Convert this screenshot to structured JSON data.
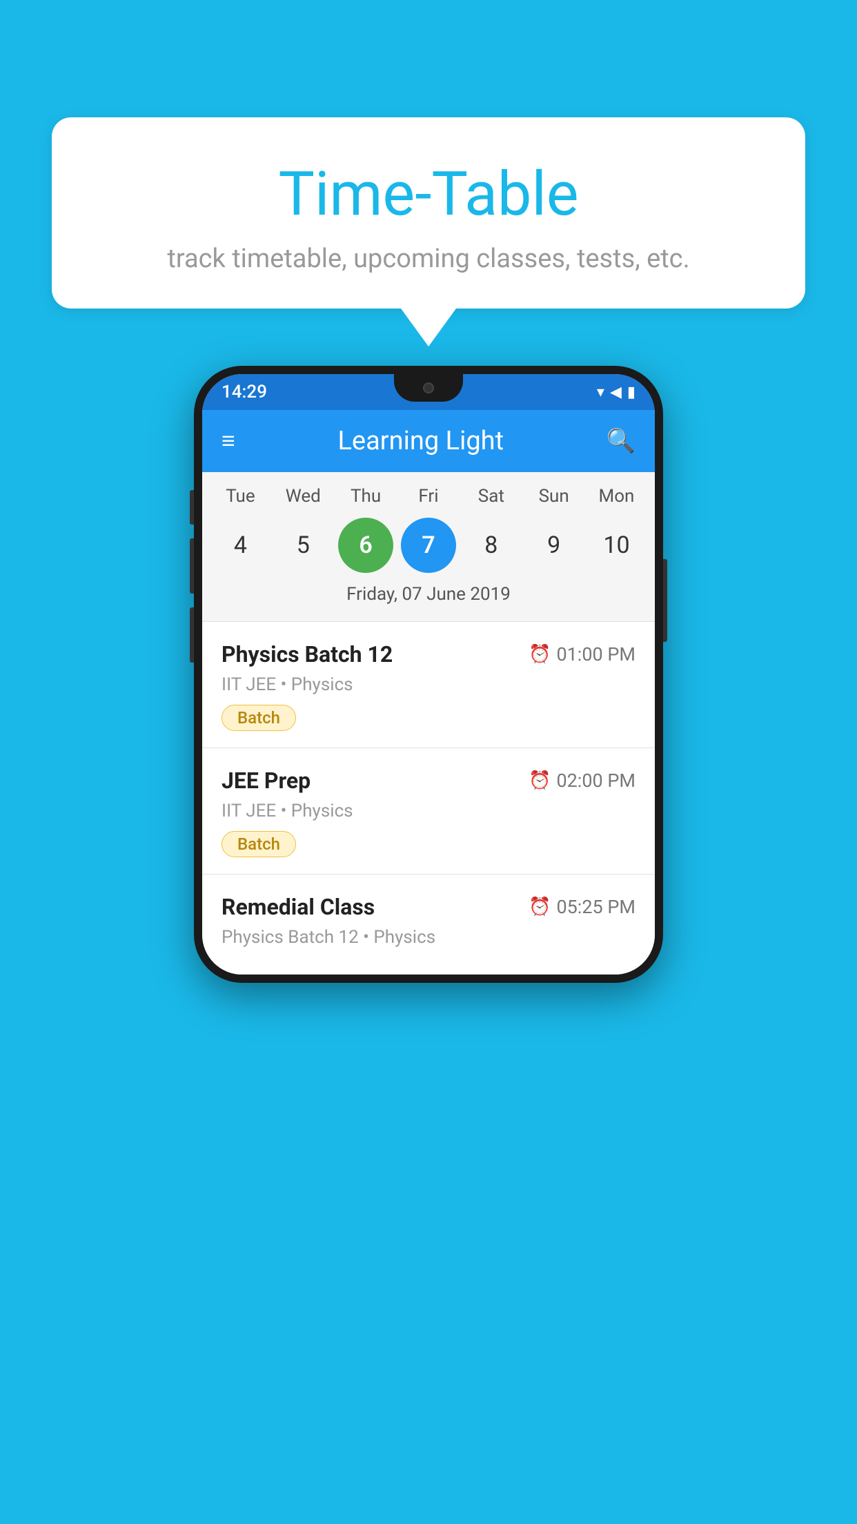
{
  "background_color": "#1ab8e8",
  "speech_bubble": {
    "title": "Time-Table",
    "subtitle": "track timetable, upcoming classes, tests, etc."
  },
  "phone": {
    "status_bar": {
      "time": "14:29",
      "icons": [
        "▼",
        "◀",
        "▮"
      ]
    },
    "app_bar": {
      "title": "Learning Light",
      "menu_label": "≡",
      "search_label": "🔍"
    },
    "calendar": {
      "days": [
        "Tue",
        "Wed",
        "Thu",
        "Fri",
        "Sat",
        "Sun",
        "Mon"
      ],
      "numbers": [
        4,
        5,
        6,
        7,
        8,
        9,
        10
      ],
      "today_index": 2,
      "selected_index": 3,
      "selected_date_label": "Friday, 07 June 2019"
    },
    "classes": [
      {
        "name": "Physics Batch 12",
        "time": "01:00 PM",
        "meta": "IIT JEE • Physics",
        "badge": "Batch"
      },
      {
        "name": "JEE Prep",
        "time": "02:00 PM",
        "meta": "IIT JEE • Physics",
        "badge": "Batch"
      },
      {
        "name": "Remedial Class",
        "time": "05:25 PM",
        "meta": "Physics Batch 12 • Physics",
        "badge": null
      }
    ]
  }
}
